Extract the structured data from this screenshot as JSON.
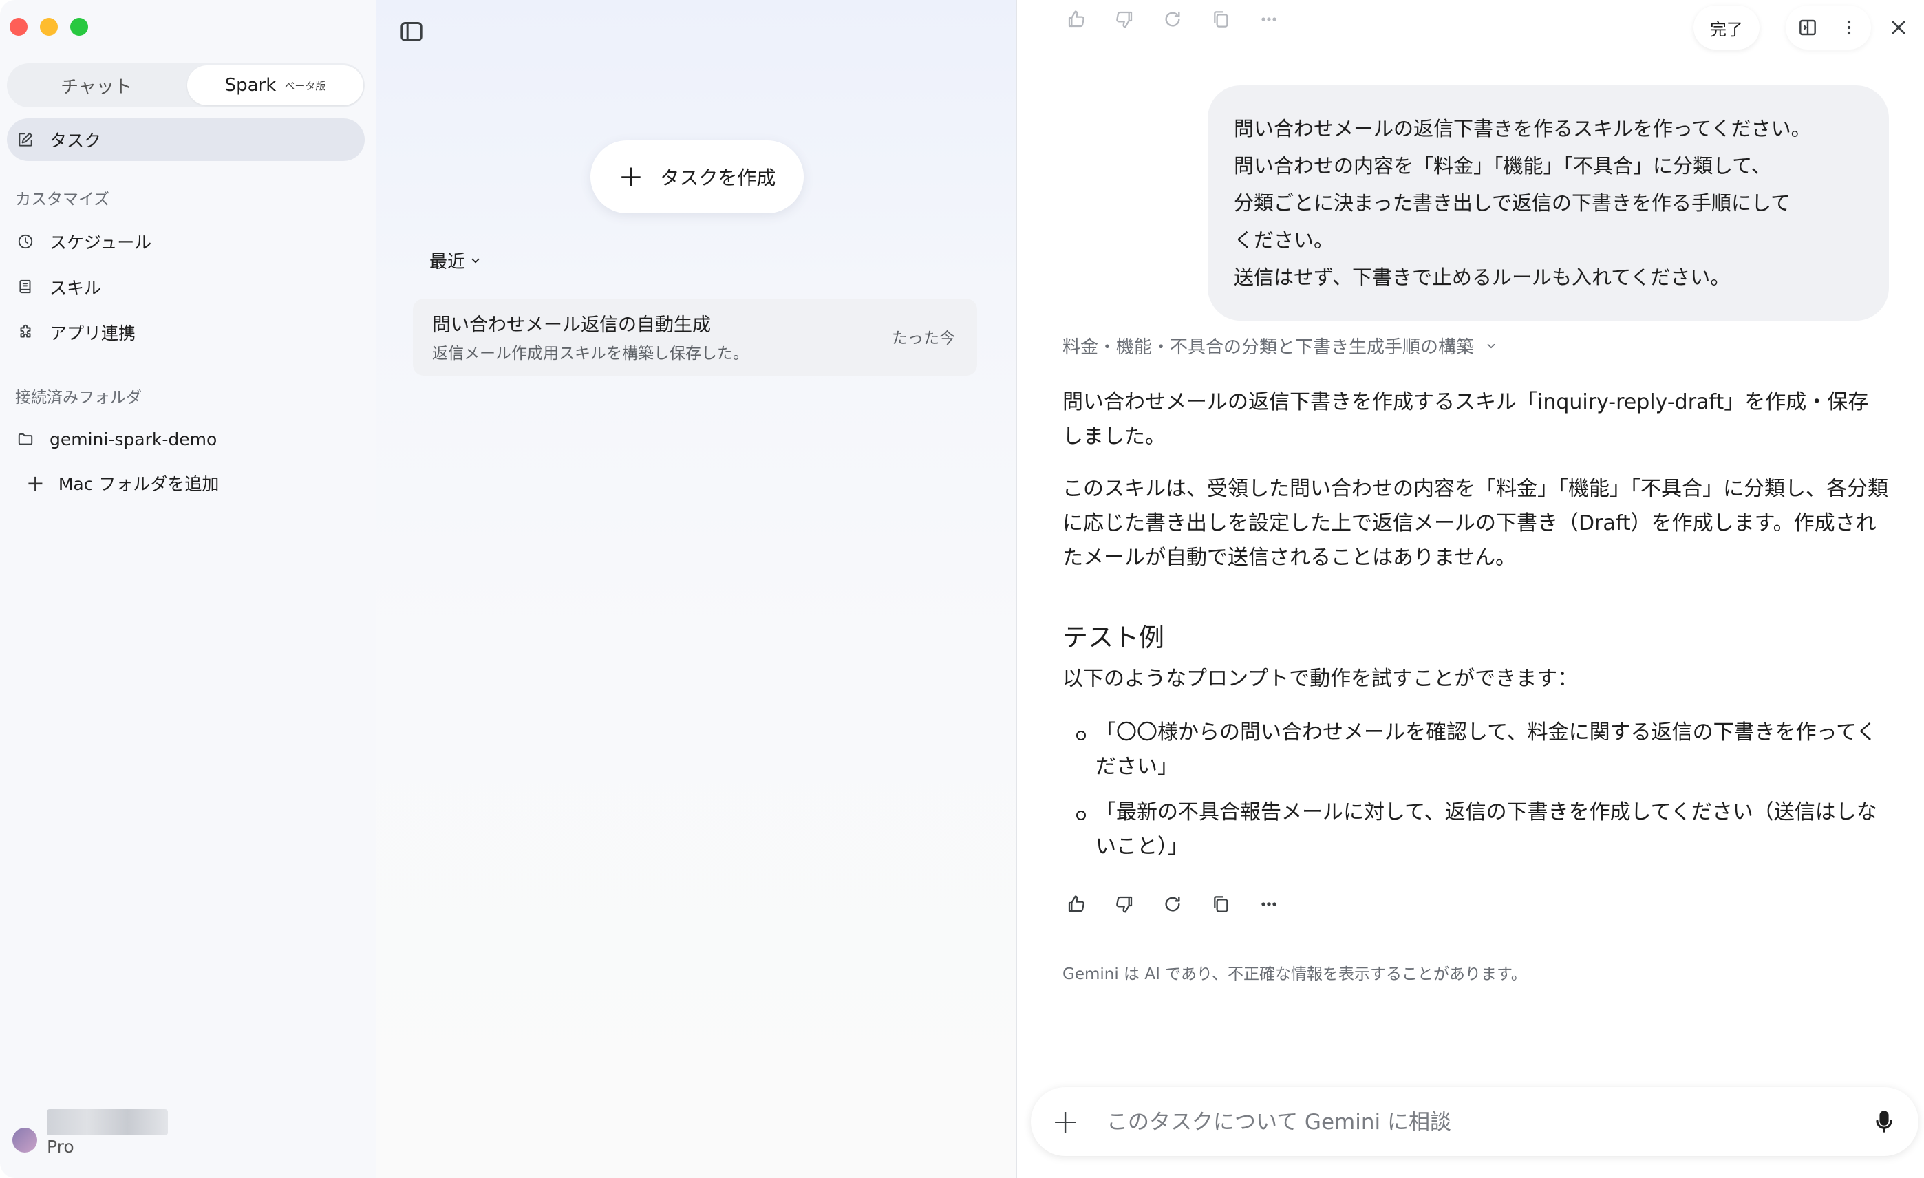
{
  "sidebar": {
    "tabs": {
      "chat": "チャット",
      "spark": "Spark",
      "beta": "ベータ版"
    },
    "task": "タスク",
    "customize_label": "カスタマイズ",
    "customize_items": [
      "スケジュール",
      "スキル",
      "アプリ連携"
    ],
    "folders_label": "接続済みフォルダ",
    "folder": "gemini-spark-demo",
    "add_folder": "Mac フォルダを追加",
    "plan": "Pro"
  },
  "middle": {
    "create_task": "タスクを作成",
    "recent": "最近",
    "task_item": {
      "title": "問い合わせメール返信の自動生成",
      "subtitle": "返信メール作成用スキルを構築し保存した。",
      "time": "たった今"
    }
  },
  "right": {
    "done": "完了",
    "user_message": [
      "問い合わせメールの返信下書きを作るスキルを作ってください。",
      "問い合わせの内容を「料金」「機能」「不具合」に分類して、",
      "分類ごとに決まった書き出しで返信の下書きを作る手順にして",
      "ください。",
      "送信はせず、下書きで止めるルールも入れてください。"
    ],
    "thinking": "料金・機能・不具合の分類と下書き生成手順の構築",
    "para1": "問い合わせメールの返信下書きを作成するスキル「inquiry-reply-draft」を作成・保存しました。",
    "para2": "このスキルは、受領した問い合わせの内容を「料金」「機能」「不具合」に分類し、各分類に応じた書き出しを設定した上で返信メールの下書き（Draft）を作成します。作成されたメールが自動で送信されることはありません。",
    "heading": "テスト例",
    "intro": "以下のようなプロンプトで動作を試すことができます：",
    "bullets": [
      "「〇〇様からの問い合わせメールを確認して、料金に関する返信の下書きを作ってください」",
      "「最新の不具合報告メールに対して、返信の下書きを作成してください（送信はしないこと）」"
    ],
    "disclaimer": "Gemini は AI であり、不正確な情報を表示することがあります。",
    "composer_placeholder": "このタスクについて Gemini に相談"
  },
  "icons": {
    "task": "edit-icon",
    "schedule": "clock-icon",
    "skill": "book-icon",
    "apps": "puzzle-icon",
    "folder": "folder-icon"
  }
}
